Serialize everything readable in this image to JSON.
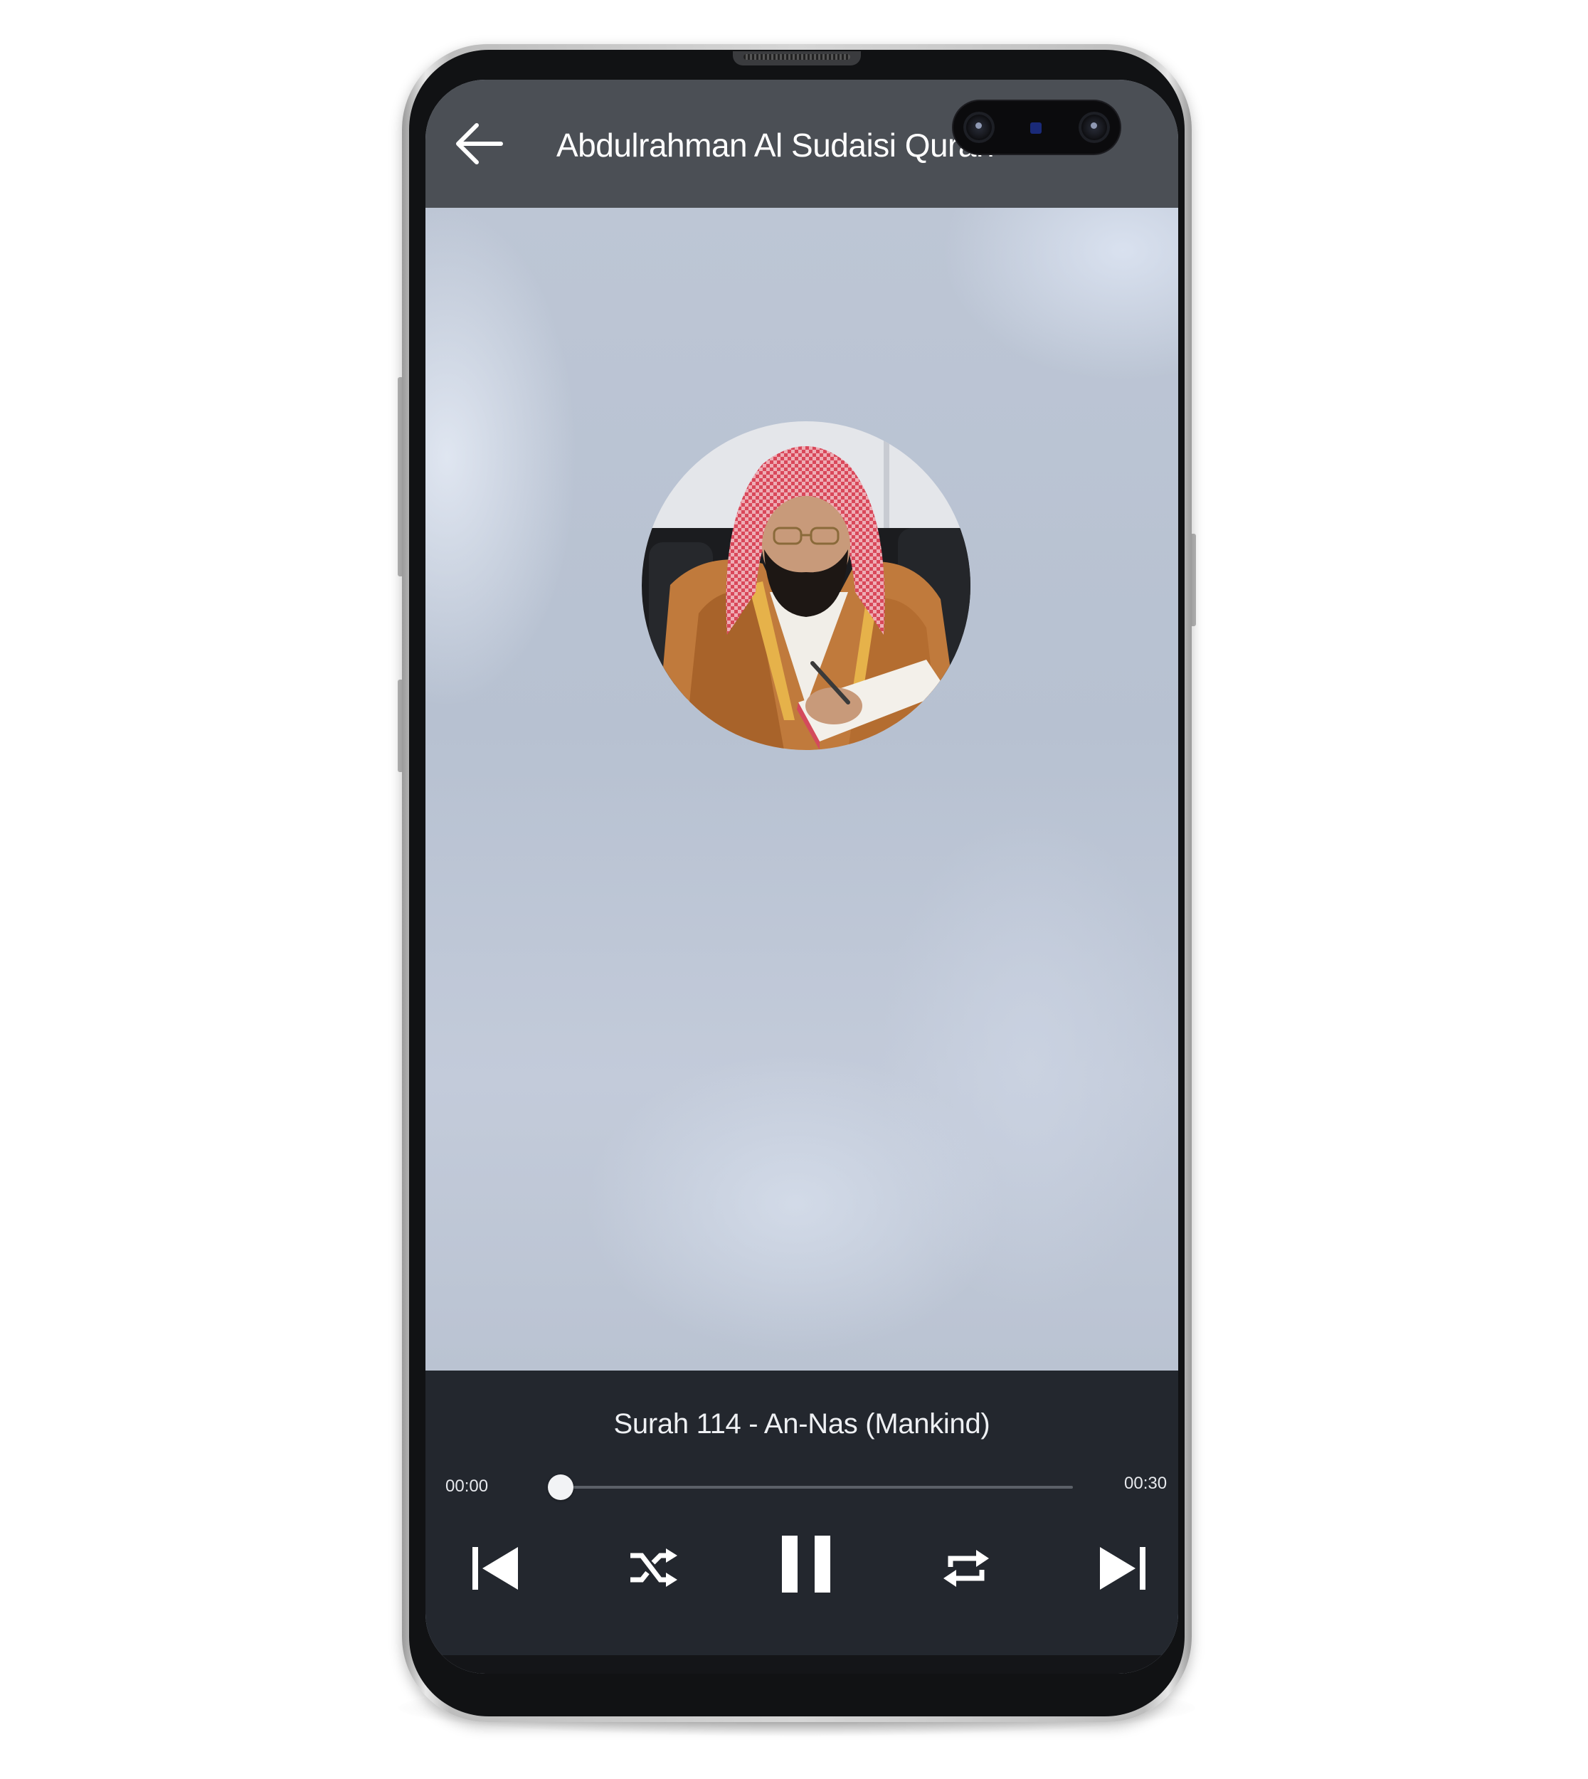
{
  "app_bar": {
    "title": "Abdulrahman Al Sudaisi Quran"
  },
  "content": {
    "reciter_photo_icon": "reciter-portrait"
  },
  "player": {
    "track_title": "Surah 114 - An-Nas (Mankind)",
    "time_elapsed": "00:00",
    "time_total": "00:30",
    "progress_fraction": 0.0,
    "controls": [
      "skip-previous-icon",
      "shuffle-icon",
      "pause-icon",
      "repeat-icon",
      "skip-next-icon"
    ]
  },
  "colors": {
    "app_bar": "#4b4f55",
    "player_panel": "#23272e",
    "content_background": "#b8c2d2",
    "icon": "#ffffff"
  }
}
